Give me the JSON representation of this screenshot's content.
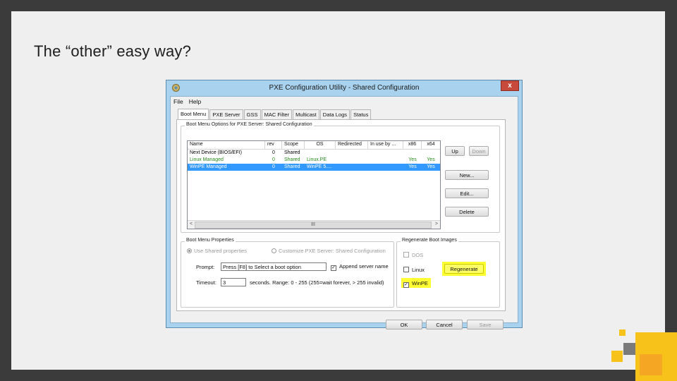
{
  "slide": {
    "title": "The “other” easy way?"
  },
  "window": {
    "title": "PXE Configuration Utility - Shared Configuration",
    "close": "x"
  },
  "menu": [
    "File",
    "Help"
  ],
  "tabs": [
    "Boot Menu",
    "PXE Server",
    "GSS",
    "MAC Filter",
    "Multicast",
    "Data Logs",
    "Status"
  ],
  "boot_menu_options": {
    "group_label": "Boot Menu Options for PXE Server:  Shared Configuration",
    "columns": [
      "Name",
      "rev",
      "Scope",
      "OS",
      "Redirected",
      "In use by ...",
      "x86",
      "x64"
    ],
    "rows": [
      [
        "Next Device (BIOS/EFI)",
        "0",
        "Shared",
        "",
        "",
        "",
        "",
        ""
      ],
      [
        "Linux Managed",
        "0",
        "Shared",
        "Linux.PE",
        "",
        "",
        "Yes",
        "Yes"
      ],
      [
        "WinPE Managed",
        "0",
        "Shared",
        "WinPE 5....",
        "",
        "",
        "Yes",
        "Yes"
      ]
    ],
    "scroll_left": "<",
    "scroll_right": ">",
    "scroll_thumb": "III"
  },
  "side_buttons": {
    "up": "Up",
    "down": "Down",
    "new": "New...",
    "edit": "Edit...",
    "delete": "Delete"
  },
  "properties": {
    "group_label": "Boot Menu Properties",
    "radio_shared": "Use Shared properties",
    "radio_custom": "Customize PXE Server:  Shared Configuration",
    "prompt_label": "Prompt:",
    "prompt_value": "Press [F8] to Select a boot option",
    "append_label": "Append server name",
    "timeout_label": "Timeout:",
    "timeout_value": "3",
    "timeout_hint": "seconds.  Range: 0 - 255 (255=wait forever, > 255 invalid)"
  },
  "regenerate": {
    "group_label": "Regenerate Boot Images",
    "dos": "DOS",
    "linux": "Linux",
    "winpe": "WinPE",
    "button": "Regenerate"
  },
  "footer": {
    "ok": "OK",
    "cancel": "Cancel",
    "save": "Save"
  },
  "colors": {
    "accent_orange": "#f5a623",
    "accent_yellow": "#f7c21a",
    "accent_gray": "#7a7a7a",
    "highlight": "#ffff33"
  }
}
